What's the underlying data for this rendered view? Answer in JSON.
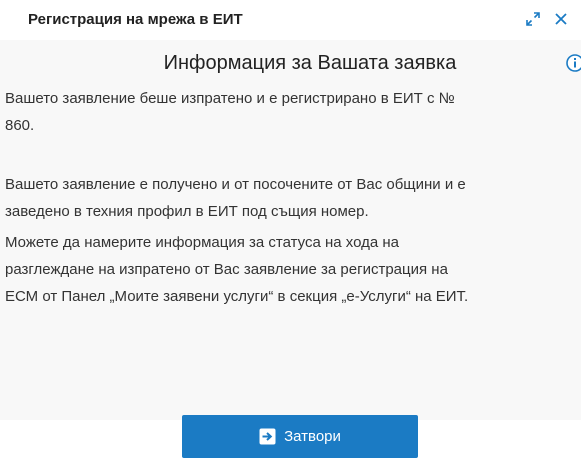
{
  "dialog": {
    "title": "Регистрация на мрежа в ЕИТ"
  },
  "content": {
    "heading": "Информация за Вашата заявка",
    "paragraphs": [
      {
        "line1": "Вашето заявление беше изпратено и е регистрирано в ЕИТ с №",
        "line2": "860."
      },
      {
        "line1": "Вашето заявление е получено и от посочените от Вас общини и е",
        "line2": "заведено в техния профил в ЕИТ под същия номер."
      },
      {
        "line1": "Можете да намерите информация за статуса на хода на",
        "line2": "разглеждане на изпратено от Вас заявление за регистрация на",
        "line3": "ЕСМ от Панел „Моите заявени услуги“ в секция „е-Услуги“ на ЕИТ."
      }
    ]
  },
  "footer": {
    "close_label": "Затвори"
  },
  "colors": {
    "accent": "#1b7bc4",
    "content_background": "#f8f8f8",
    "text": "#333333"
  },
  "icons": {
    "expand": "expand-arrows-icon",
    "close": "close-x-icon",
    "info": "info-circle-icon",
    "button": "arrow-right-square-icon"
  }
}
